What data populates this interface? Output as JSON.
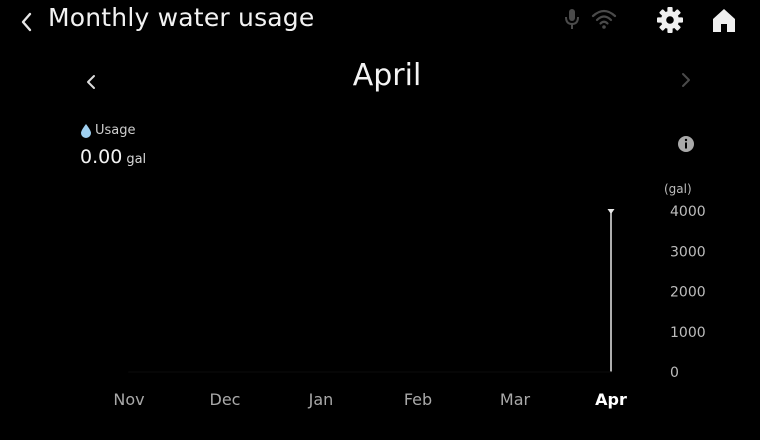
{
  "header": {
    "title": "Monthly water usage",
    "icons": {
      "back": "back-chevron-icon",
      "mic": "microphone-icon",
      "wifi": "wifi-icon",
      "settings": "gear-icon",
      "home": "home-icon"
    }
  },
  "month_nav": {
    "current_month": "April",
    "prev": "chevron-left-icon",
    "next": "chevron-right-icon"
  },
  "usage": {
    "label": "Usage",
    "value": "0.00",
    "unit": "gal",
    "icon": "water-drop-icon"
  },
  "info": {
    "icon": "info-icon"
  },
  "colors": {
    "background": "#000000",
    "text": "#f2f2f2",
    "muted_text": "#a9a9a9",
    "selected_month": "#ffffff",
    "usage_drop": "#9fd0f0",
    "inactive_icon": "#4a4a4a"
  },
  "chart_data": {
    "type": "line",
    "categories": [
      "Nov",
      "Dec",
      "Jan",
      "Feb",
      "Mar",
      "Apr"
    ],
    "selected": "Apr",
    "y_unit": "(gal)",
    "ylim": [
      0,
      4000
    ],
    "yticks": [
      0,
      1000,
      2000,
      3000,
      4000
    ],
    "series": [
      {
        "values": [
          0,
          0,
          0,
          0,
          0,
          0
        ]
      }
    ],
    "cursor_at": "Apr",
    "grid": false
  }
}
